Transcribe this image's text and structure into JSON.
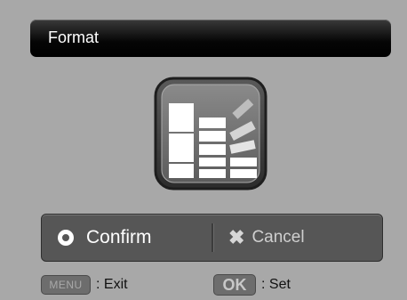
{
  "header": {
    "title": "Format"
  },
  "icon": {
    "name": "format-memory-icon"
  },
  "options": {
    "confirm_label": "Confirm",
    "cancel_label": "Cancel",
    "selected": "Confirm"
  },
  "footer": {
    "menu_key": "MENU",
    "menu_action": ": Exit",
    "ok_key": "OK",
    "ok_action": ": Set"
  },
  "colors": {
    "background": "#a8a8a8",
    "title_bar": "#000000",
    "option_bar": "#565656",
    "text_primary": "#ffffff"
  }
}
